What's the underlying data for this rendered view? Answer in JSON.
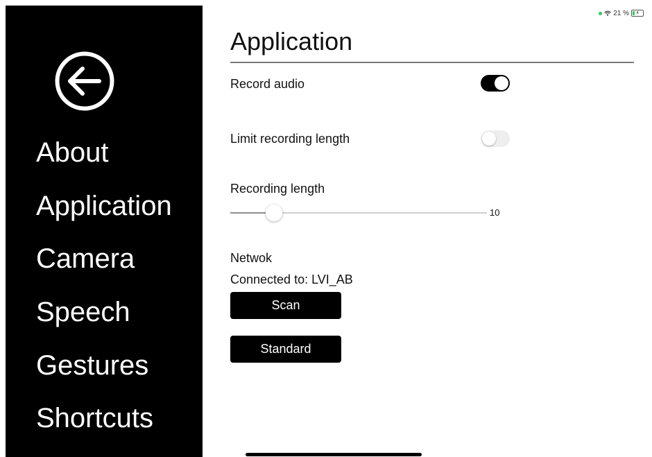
{
  "status_bar": {
    "battery_text": "21 %",
    "battery_level": 0.21,
    "indicator_color": "#34c759"
  },
  "sidebar": {
    "back_icon": "arrow-left-circle-icon",
    "items": [
      {
        "id": "about",
        "label": "About"
      },
      {
        "id": "application",
        "label": "Application"
      },
      {
        "id": "camera",
        "label": "Camera"
      },
      {
        "id": "speech",
        "label": "Speech"
      },
      {
        "id": "gestures",
        "label": "Gestures"
      },
      {
        "id": "shortcuts",
        "label": "Shortcuts"
      }
    ]
  },
  "main": {
    "title": "Application",
    "record_audio": {
      "label": "Record audio",
      "on": true
    },
    "limit_length": {
      "label": "Limit recording length",
      "on": false
    },
    "recording_length": {
      "label": "Recording length",
      "value": "10",
      "fraction": 0.17
    },
    "network": {
      "heading": "Netwok",
      "connected_text": "Connected to: LVI_AB",
      "scan_label": "Scan",
      "standard_label": "Standard"
    }
  }
}
